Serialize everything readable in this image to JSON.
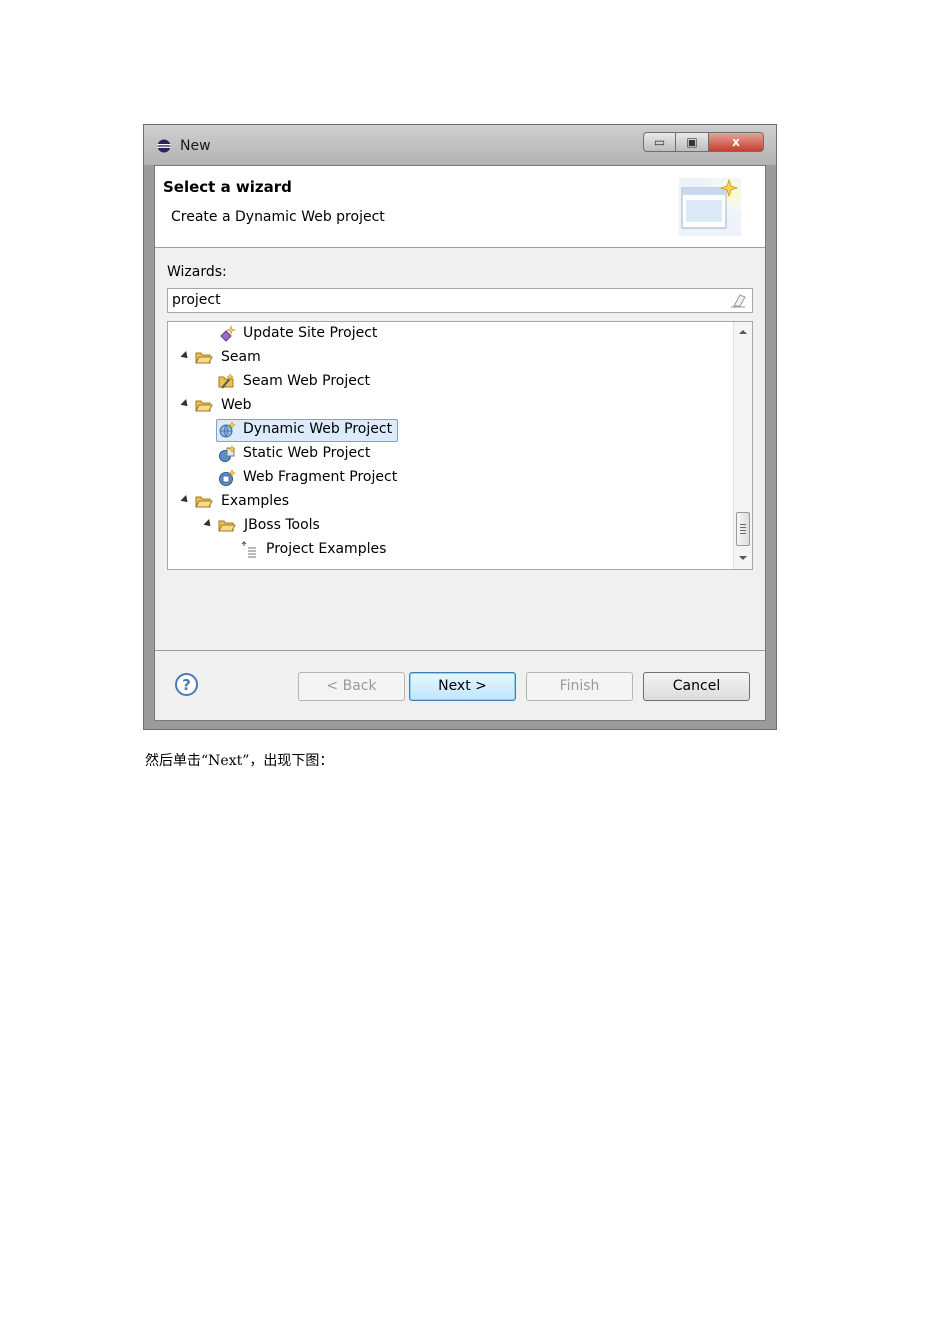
{
  "window": {
    "title": "New",
    "controls": {
      "minimize": "▭",
      "maximize": "▣",
      "close": "x"
    }
  },
  "banner": {
    "title": "Select a wizard",
    "description": "Create a Dynamic Web project",
    "image_icon": "new-wizard-window-icon"
  },
  "wizards": {
    "label": "Wizards:",
    "filter_value": "project",
    "tree": [
      {
        "label": "Update Site Project",
        "icon": "update-site-icon"
      },
      {
        "label": "Seam",
        "icon": "folder-open-icon",
        "expanded": true
      },
      {
        "label": "Seam Web Project",
        "icon": "seam-project-icon"
      },
      {
        "label": "Web",
        "icon": "folder-open-icon",
        "expanded": true
      },
      {
        "label": "Dynamic Web Project",
        "icon": "web-project-icon",
        "selected": true
      },
      {
        "label": "Static Web Project",
        "icon": "static-web-icon"
      },
      {
        "label": "Web Fragment Project",
        "icon": "web-fragment-icon"
      },
      {
        "label": "Examples",
        "icon": "folder-open-icon",
        "expanded": true
      },
      {
        "label": "JBoss Tools",
        "icon": "folder-open-icon",
        "expanded": true
      },
      {
        "label": "Project Examples",
        "icon": "project-examples-icon"
      }
    ]
  },
  "buttons": {
    "help": "?",
    "back": "< Back",
    "next": "Next >",
    "finish": "Finish",
    "cancel": "Cancel"
  },
  "caption": "然后单击“Next”，出现下图："
}
